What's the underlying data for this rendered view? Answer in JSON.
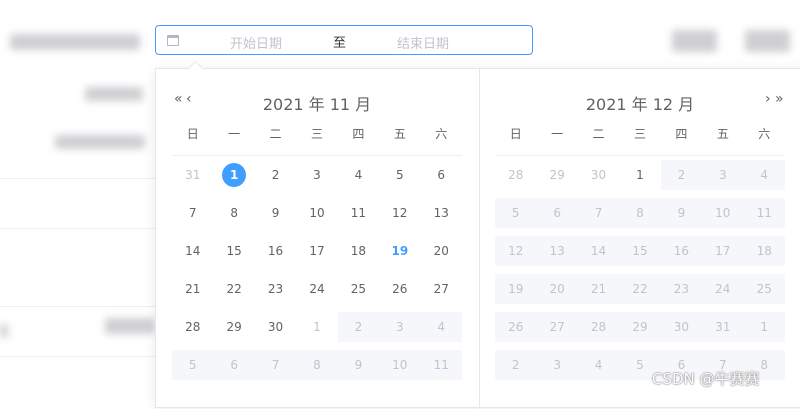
{
  "range": {
    "start_placeholder": "开始日期",
    "separator": "至",
    "end_placeholder": "结束日期"
  },
  "left_panel": {
    "title": "2021 年 11 月",
    "prev_year": "«",
    "prev_month": "‹",
    "weekdays": [
      "日",
      "一",
      "二",
      "三",
      "四",
      "五",
      "六"
    ],
    "rows": [
      [
        {
          "d": "31",
          "t": "other"
        },
        {
          "d": "1",
          "t": "selected"
        },
        {
          "d": "2"
        },
        {
          "d": "3"
        },
        {
          "d": "4"
        },
        {
          "d": "5"
        },
        {
          "d": "6"
        }
      ],
      [
        {
          "d": "7"
        },
        {
          "d": "8"
        },
        {
          "d": "9"
        },
        {
          "d": "10"
        },
        {
          "d": "11"
        },
        {
          "d": "12"
        },
        {
          "d": "13"
        }
      ],
      [
        {
          "d": "14"
        },
        {
          "d": "15"
        },
        {
          "d": "16"
        },
        {
          "d": "17"
        },
        {
          "d": "18"
        },
        {
          "d": "19",
          "t": "today"
        },
        {
          "d": "20"
        }
      ],
      [
        {
          "d": "21"
        },
        {
          "d": "22"
        },
        {
          "d": "23"
        },
        {
          "d": "24"
        },
        {
          "d": "25"
        },
        {
          "d": "26"
        },
        {
          "d": "27"
        }
      ],
      [
        {
          "d": "28"
        },
        {
          "d": "29"
        },
        {
          "d": "30"
        },
        {
          "d": "1",
          "t": "other"
        },
        {
          "d": "2",
          "t": "disabled"
        },
        {
          "d": "3",
          "t": "disabled"
        },
        {
          "d": "4",
          "t": "disabled"
        }
      ],
      [
        {
          "d": "5",
          "t": "disabled"
        },
        {
          "d": "6",
          "t": "disabled"
        },
        {
          "d": "7",
          "t": "disabled"
        },
        {
          "d": "8",
          "t": "disabled"
        },
        {
          "d": "9",
          "t": "disabled"
        },
        {
          "d": "10",
          "t": "disabled"
        },
        {
          "d": "11",
          "t": "disabled"
        }
      ]
    ]
  },
  "right_panel": {
    "title": "2021 年 12 月",
    "next_month": "›",
    "next_year": "»",
    "weekdays": [
      "日",
      "一",
      "二",
      "三",
      "四",
      "五",
      "六"
    ],
    "rows": [
      [
        {
          "d": "28",
          "t": "other"
        },
        {
          "d": "29",
          "t": "other"
        },
        {
          "d": "30",
          "t": "other"
        },
        {
          "d": "1"
        },
        {
          "d": "2",
          "t": "disabled"
        },
        {
          "d": "3",
          "t": "disabled"
        },
        {
          "d": "4",
          "t": "disabled"
        }
      ],
      [
        {
          "d": "5",
          "t": "disabled"
        },
        {
          "d": "6",
          "t": "disabled"
        },
        {
          "d": "7",
          "t": "disabled"
        },
        {
          "d": "8",
          "t": "disabled"
        },
        {
          "d": "9",
          "t": "disabled"
        },
        {
          "d": "10",
          "t": "disabled"
        },
        {
          "d": "11",
          "t": "disabled"
        }
      ],
      [
        {
          "d": "12",
          "t": "disabled"
        },
        {
          "d": "13",
          "t": "disabled"
        },
        {
          "d": "14",
          "t": "disabled"
        },
        {
          "d": "15",
          "t": "disabled"
        },
        {
          "d": "16",
          "t": "disabled"
        },
        {
          "d": "17",
          "t": "disabled"
        },
        {
          "d": "18",
          "t": "disabled"
        }
      ],
      [
        {
          "d": "19",
          "t": "disabled"
        },
        {
          "d": "20",
          "t": "disabled"
        },
        {
          "d": "21",
          "t": "disabled"
        },
        {
          "d": "22",
          "t": "disabled"
        },
        {
          "d": "23",
          "t": "disabled"
        },
        {
          "d": "24",
          "t": "disabled"
        },
        {
          "d": "25",
          "t": "disabled"
        }
      ],
      [
        {
          "d": "26",
          "t": "disabled"
        },
        {
          "d": "27",
          "t": "disabled"
        },
        {
          "d": "28",
          "t": "disabled"
        },
        {
          "d": "29",
          "t": "disabled"
        },
        {
          "d": "30",
          "t": "disabled"
        },
        {
          "d": "31",
          "t": "disabled"
        },
        {
          "d": "1",
          "t": "disabled"
        }
      ],
      [
        {
          "d": "2",
          "t": "disabled"
        },
        {
          "d": "3",
          "t": "disabled"
        },
        {
          "d": "4",
          "t": "disabled"
        },
        {
          "d": "5",
          "t": "disabled"
        },
        {
          "d": "6",
          "t": "disabled"
        },
        {
          "d": "7",
          "t": "disabled"
        },
        {
          "d": "8",
          "t": "disabled"
        }
      ]
    ]
  },
  "watermark": "CSDN @牛赛赛",
  "colors": {
    "accent": "#409eff",
    "disabled_bg": "#f5f7fa",
    "muted_text": "#c0c4cc"
  }
}
